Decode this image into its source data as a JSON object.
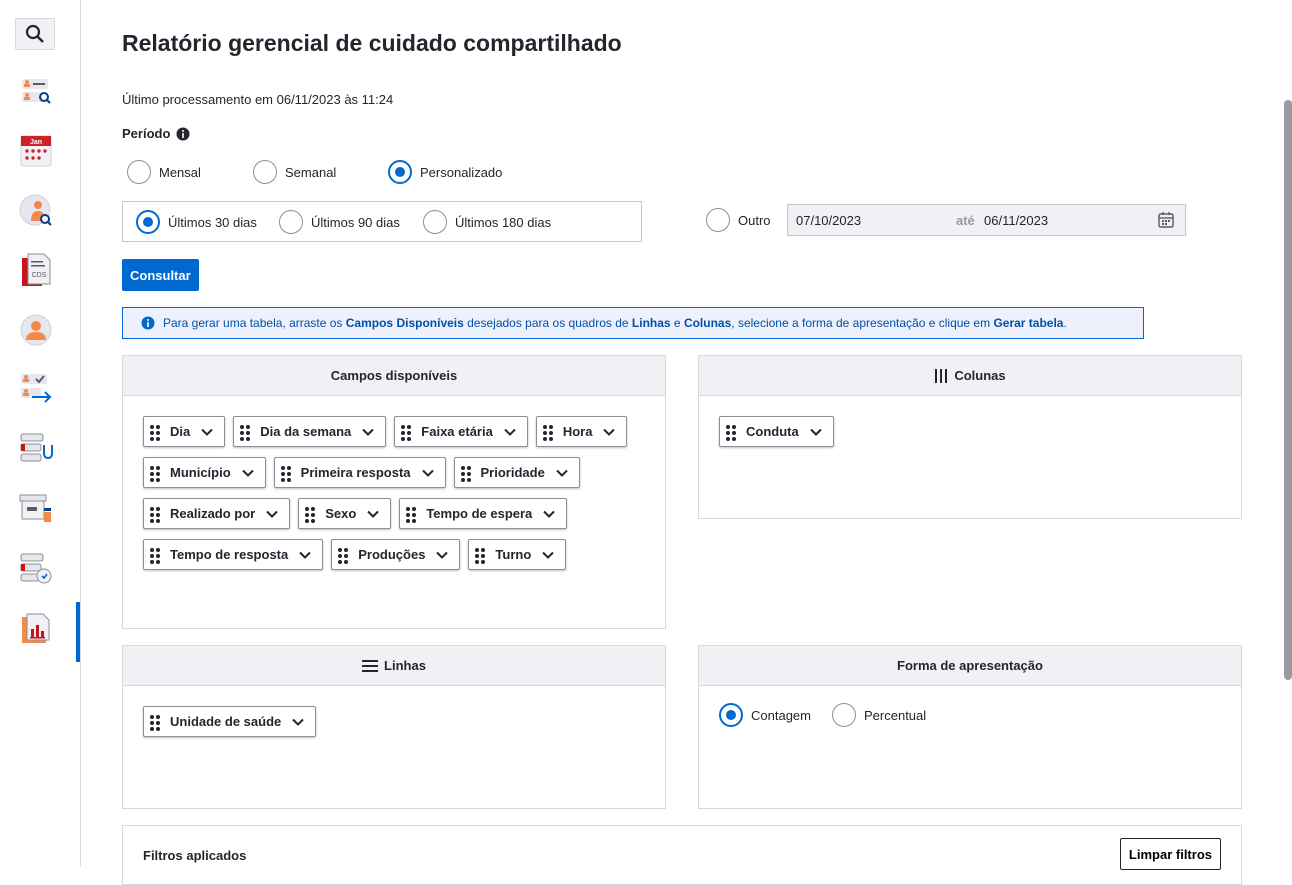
{
  "sidebar": {
    "items": [
      {
        "icon": "search-icon"
      },
      {
        "icon": "user-list-search-icon"
      },
      {
        "icon": "calendar-icon",
        "text": "Jan"
      },
      {
        "icon": "user-search-icon"
      },
      {
        "icon": "cds-document-icon",
        "text": "CDS"
      },
      {
        "icon": "user-avatar-icon"
      },
      {
        "icon": "user-transfer-icon"
      },
      {
        "icon": "stethoscope-list-icon"
      },
      {
        "icon": "box-supplies-icon"
      },
      {
        "icon": "list-clock-icon"
      },
      {
        "icon": "report-chart-icon",
        "active": true
      }
    ]
  },
  "header": {
    "title": "Relatório gerencial de cuidado compartilhado",
    "last_processed": "Último processamento em 06/11/2023 às 11:24"
  },
  "period": {
    "label": "Período",
    "types": [
      "Mensal",
      "Semanal",
      "Personalizado"
    ],
    "selected_type": "Personalizado",
    "ranges": [
      "Últimos 30 dias",
      "Últimos 90 dias",
      "Últimos 180 dias"
    ],
    "selected_range": "Últimos 30 dias",
    "other_label": "Outro",
    "date_from": "07/10/2023",
    "until_label": "até",
    "date_to": "06/11/2023"
  },
  "consult_label": "Consultar",
  "info": {
    "t1": "Para gerar uma tabela, arraste os ",
    "b1": "Campos Disponíveis",
    "t2": " desejados para os quadros de ",
    "b2": "Linhas",
    "t3": " e ",
    "b3": "Colunas",
    "t4": ", selecione a forma de apresentação e clique em ",
    "b4": "Gerar tabela",
    "t5": "."
  },
  "available": {
    "title": "Campos disponíveis",
    "fields": [
      "Dia",
      "Dia da semana",
      "Faixa etária",
      "Hora",
      "Município",
      "Primeira resposta",
      "Prioridade",
      "Realizado por",
      "Sexo",
      "Tempo de espera",
      "Tempo de resposta",
      "Produções",
      "Turno"
    ]
  },
  "columns": {
    "title": "Colunas",
    "fields": [
      "Conduta"
    ]
  },
  "rows": {
    "title": "Linhas",
    "fields": [
      "Unidade de saúde"
    ]
  },
  "presentation": {
    "title": "Forma de apresentação",
    "options": [
      "Contagem",
      "Percentual"
    ],
    "selected": "Contagem"
  },
  "filters": {
    "title": "Filtros aplicados",
    "clear_label": "Limpar filtros"
  },
  "colors": {
    "accent": "#0069d0",
    "panel_header": "#f0f0f5"
  }
}
